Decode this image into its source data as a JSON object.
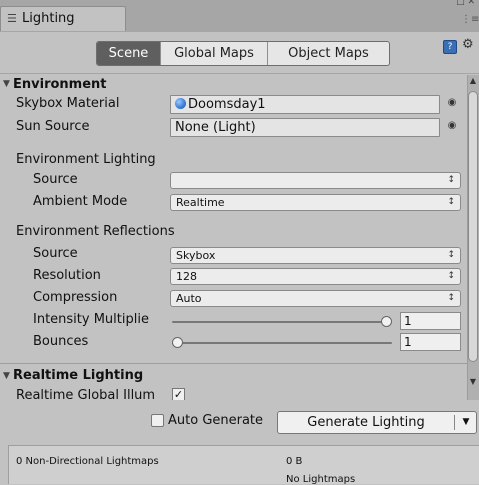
{
  "window": {
    "tab_title": "Lighting",
    "tab_icon": "lighting-icon",
    "controls": "□ ✕",
    "menu_icon": "⋮≡"
  },
  "toolbar": {
    "tabs": [
      "Scene",
      "Global Maps",
      "Object Maps"
    ],
    "active_tab": "Scene",
    "help_icon": "help-book-icon",
    "settings_icon": "gear-icon"
  },
  "environment": {
    "header": "Environment",
    "skybox_material_label": "Skybox Material",
    "skybox_material_value": "Doomsday1",
    "sun_source_label": "Sun Source",
    "sun_source_value": "None (Light)",
    "env_lighting_label": "Environment Lighting",
    "source_label": "Source",
    "source_value": "",
    "ambient_mode_label": "Ambient Mode",
    "ambient_mode_value": "Realtime",
    "reflections_label": "Environment Reflections",
    "refl_source_label": "Source",
    "refl_source_value": "Skybox",
    "resolution_label": "Resolution",
    "resolution_value": "128",
    "compression_label": "Compression",
    "compression_value": "Auto",
    "intensity_label": "Intensity Multiplie",
    "intensity_value": "1",
    "intensity_slider_fraction": 1.0,
    "bounces_label": "Bounces",
    "bounces_value": "1",
    "bounces_slider_fraction": 0.0
  },
  "realtime": {
    "header": "Realtime Lighting",
    "gi_label": "Realtime Global Illum",
    "gi_checked": true
  },
  "bottom": {
    "auto_generate_label": "Auto Generate",
    "auto_generate_checked": false,
    "generate_label": "Generate Lighting",
    "stats_label": "0 Non-Directional Lightmaps",
    "stats_size": "0 B",
    "stats_none": "No Lightmaps"
  },
  "colors": {
    "panel": "#c2c2c2",
    "active_tab": "#5f5f5f",
    "material_icon": "#3a7bd5"
  }
}
